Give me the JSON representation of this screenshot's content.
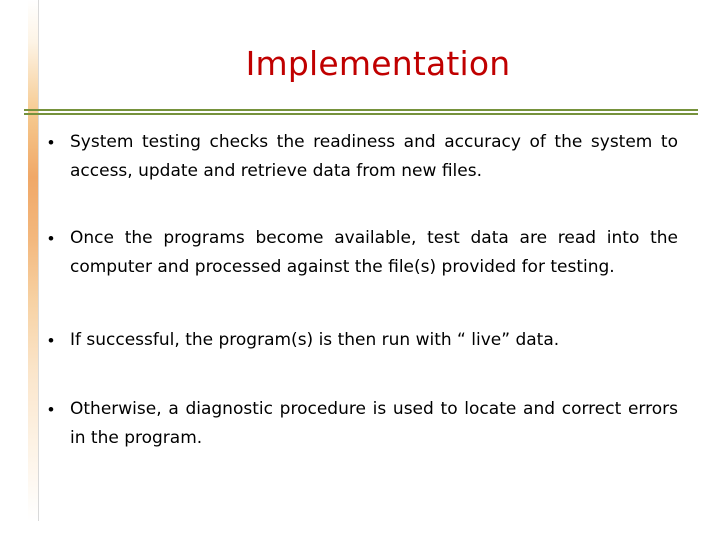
{
  "slide": {
    "title": "Implementation",
    "accent_color": "#c00000",
    "divider_color": "#76923c",
    "sidebar_gradient_color": "#f0a868",
    "bullet_marker": "•",
    "bullets": [
      "System testing checks the readiness and accuracy of the system to access, update and retrieve data from new files.",
      "Once the programs become available, test data are read into the computer and processed against the file(s) provided for testing.",
      "If successful, the program(s) is then run with “ live” data.",
      "Otherwise, a diagnostic procedure is used to locate and correct errors in the program."
    ]
  }
}
